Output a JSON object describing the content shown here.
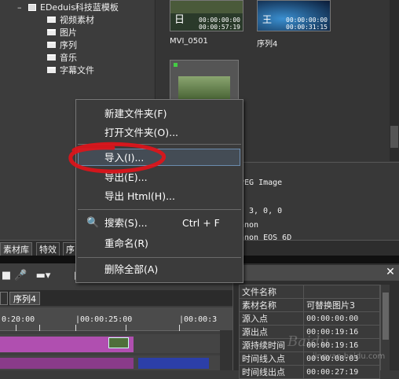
{
  "bin_tree": {
    "root_label": "EDeduis科技蓝模板",
    "folders": [
      "视频素材",
      "图片",
      "序列",
      "音乐",
      "字幕文件"
    ]
  },
  "thumbnails": [
    {
      "name": "",
      "timecode_in": "00:00:00:00",
      "timecode_out": "00:00:57:19",
      "mark": "日"
    },
    {
      "name": "",
      "timecode_in": "00:00:00:00",
      "timecode_out": "00:00:31:15",
      "mark": "王"
    },
    {
      "name": "MVI_0501"
    },
    {
      "name": "序列4"
    }
  ],
  "properties_fragments": [
    "PEG Image",
    "3, 0, 0",
    "anon",
    "anon EOS 6D"
  ],
  "bottom_tabs": [
    "素材库",
    "特效",
    "序"
  ],
  "context_menu": {
    "items": [
      {
        "label": "新建文件夹(F)"
      },
      {
        "label": "打开文件夹(O)..."
      },
      {
        "label": "导入(I)..."
      },
      {
        "label": "导出(E)..."
      },
      {
        "label": "导出 Html(H)..."
      },
      {
        "label": "搜索(S)...",
        "shortcut": "Ctrl + F",
        "icon": "search-icon"
      },
      {
        "label": "重命名(R)"
      },
      {
        "label": "删除全部(A)"
      }
    ],
    "highlighted": "导入(I)..."
  },
  "timeline": {
    "sequence_tab": "序列4",
    "ruler_labels": [
      "0:20:00",
      "|00:00:25:00",
      "|00:00:3"
    ]
  },
  "info_table": {
    "rows": [
      {
        "key": "文件名称",
        "value": ""
      },
      {
        "key": "素材名称",
        "value": "可替换图片3"
      },
      {
        "key": "源入点",
        "value": "00:00:00:00"
      },
      {
        "key": "源出点",
        "value": "00:00:19:16"
      },
      {
        "key": "源持续时间",
        "value": "00:00:19:16"
      },
      {
        "key": "时间线入点",
        "value": "00:00:08:03"
      },
      {
        "key": "时间线出点",
        "value": "00:00:27:19"
      }
    ]
  },
  "watermark": "Baidu",
  "watermark_sub": "jingyan.baidu.com",
  "colors": {
    "annotation_red": "#e0141a",
    "clip_purple": "#b04fb0",
    "clip_blue": "#2c3fa8"
  }
}
